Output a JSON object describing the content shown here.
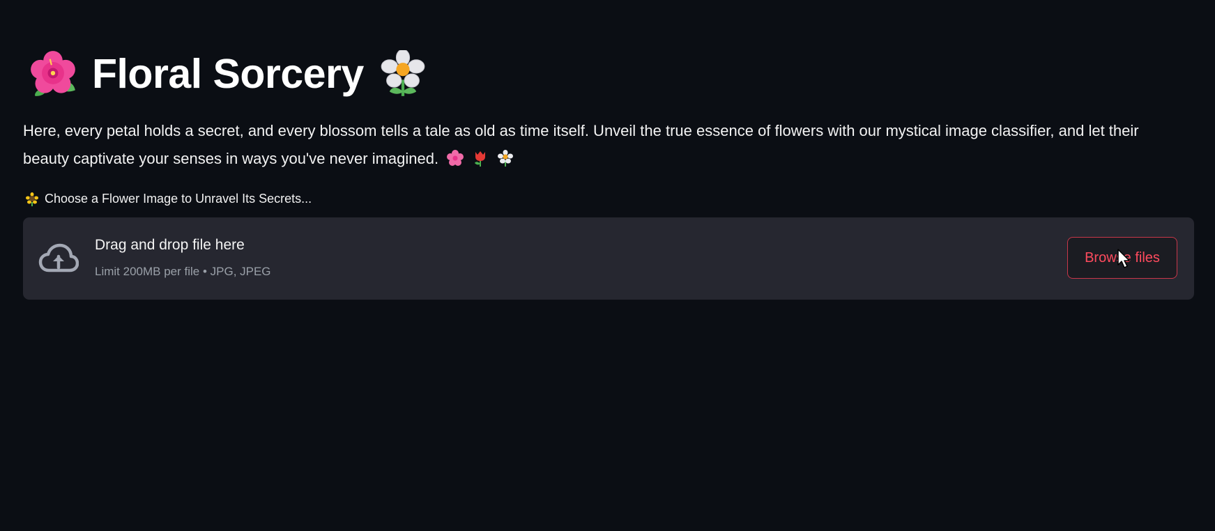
{
  "header": {
    "title": "Floral Sorcery",
    "left_icon": "hibiscus-icon",
    "right_icon": "white-flower-icon"
  },
  "description": {
    "text": "Here, every petal holds a secret, and every blossom tells a tale as old as time itself. Unveil the true essence of flowers with our mystical image classifier, and let their beauty captivate your senses in ways you've never imagined.",
    "icons": [
      "cherry-blossom-icon",
      "tulip-icon",
      "white-flower-icon"
    ]
  },
  "uploader": {
    "label": "Choose a Flower Image to Unravel Its Secrets...",
    "label_icon": "sunflower-icon",
    "drag_text": "Drag and drop file here",
    "limit_text": "Limit 200MB per file • JPG, JPEG",
    "browse_label": "Browse files",
    "upload_icon": "cloud-upload-icon"
  },
  "colors": {
    "background": "#0b0e14",
    "dropzone": "#262730",
    "accent": "#ff4b5e"
  }
}
